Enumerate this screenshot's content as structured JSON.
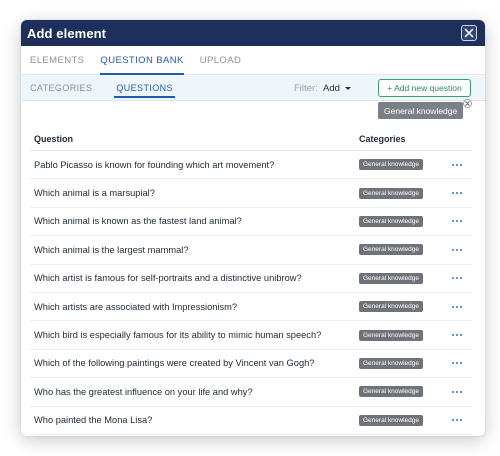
{
  "modal": {
    "title": "Add element"
  },
  "main_tabs": [
    {
      "label": "ELEMENTS",
      "active": false
    },
    {
      "label": "QUESTION BANK",
      "active": true
    },
    {
      "label": "UPLOAD",
      "active": false
    }
  ],
  "sub_tabs": [
    {
      "label": "CATEGORIES",
      "active": false
    },
    {
      "label": "QUESTIONS",
      "active": true
    }
  ],
  "filter": {
    "label": "Filter:",
    "value": "Add"
  },
  "add_new_button": "+ Add new question",
  "active_filter_chip": "General knowledge",
  "table": {
    "headers": {
      "question": "Question",
      "categories": "Categories"
    },
    "rows": [
      {
        "question": "Pablo Picasso is known for founding which art movement?",
        "category": "General knowledge"
      },
      {
        "question": "Which animal is a marsupial?",
        "category": "General knowledge"
      },
      {
        "question": "Which animal is known as the fastest land animal?",
        "category": "General knowledge"
      },
      {
        "question": "Which animal is the largest mammal?",
        "category": "General knowledge"
      },
      {
        "question": "Which artist is famous for self-portraits and a distinctive unibrow?",
        "category": "General knowledge"
      },
      {
        "question": "Which artists are associated with Impressionism?",
        "category": "General knowledge"
      },
      {
        "question": "Which bird is especially famous for its ability to mimic human speech?",
        "category": "General knowledge"
      },
      {
        "question": "Which of the following paintings were created by Vincent van Gogh?",
        "category": "General knowledge"
      },
      {
        "question": "Who has the greatest influence on your life and why?",
        "category": "General knowledge"
      },
      {
        "question": "Who painted the Mona Lisa?",
        "category": "General knowledge"
      }
    ]
  },
  "icons": {
    "close": "close-icon",
    "row_menu": "more-options-icon",
    "chip_remove": "remove-chip-icon",
    "dropdown": "caret-down-icon"
  },
  "colors": {
    "titlebar": "#1f2f5c",
    "accent": "#1f5bb3",
    "add_button": "#2f8a5c",
    "badge": "#6f7379",
    "subbar": "#eef5fb"
  }
}
